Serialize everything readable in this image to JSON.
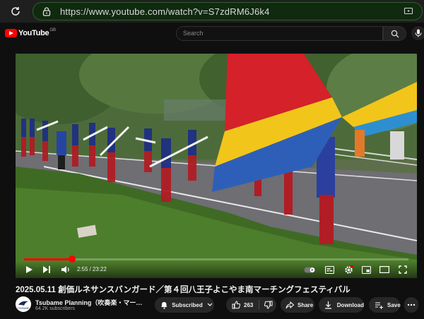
{
  "browser": {
    "url": "https://www.youtube.com/watch?v=S7zdRM6J6k4",
    "url_host": "https://www.youtube.com",
    "url_path": "/watch?v=S7zdRM6J6k4"
  },
  "header": {
    "logo_text": "YouTube",
    "logo_region": "GB",
    "search_placeholder": "Search"
  },
  "player": {
    "current_time": "2:55",
    "duration": "23:22",
    "progress_fraction": 0.125,
    "autoplay": "on"
  },
  "video": {
    "title": "2025.05.11 創価ルネサンスバンガード／第４回八王子よこやま南マーチングフェスティバル"
  },
  "channel": {
    "name": "Tsubame Planning（吹奏楽・マーチン…",
    "subscribers": "64.2K subscribers",
    "subscribed_label": "Subscribed"
  },
  "actions": {
    "like_count": "263",
    "share_label": "Share",
    "download_label": "Download",
    "save_label": "Save"
  },
  "icons": {
    "reload": "reload-icon",
    "lock": "lock-icon",
    "search": "search-icon",
    "mic": "mic-icon",
    "play": "play-icon",
    "next": "next-icon",
    "volume": "volume-icon",
    "subtitles": "subtitles-icon",
    "settings": "gear-icon",
    "miniplayer": "miniplayer-icon",
    "theater": "theater-icon",
    "fullscreen": "fullscreen-icon",
    "bell": "bell-icon",
    "like": "thumb-up-icon",
    "dislike": "thumb-down-icon",
    "share": "share-icon",
    "download": "download-icon",
    "save": "save-icon",
    "more": "more-icon"
  },
  "colors": {
    "brand_red": "#ff0000",
    "background": "#0f0f0f",
    "url_bar": "#0f2a0f"
  }
}
